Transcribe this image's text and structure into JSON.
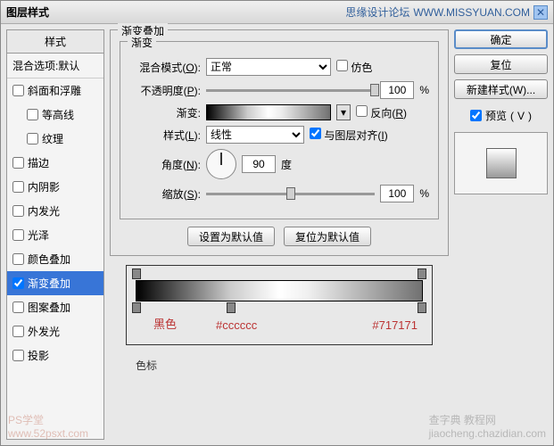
{
  "titlebar": {
    "title": "图层样式",
    "site": "思缘设计论坛",
    "url": "WWW.MISSYUAN.COM",
    "close": "✕"
  },
  "styles": {
    "header": "样式",
    "blend_opt": "混合选项:默认",
    "items": [
      {
        "label": "斜面和浮雕",
        "checked": false
      },
      {
        "label": "等高线",
        "checked": false,
        "sub": true
      },
      {
        "label": "纹理",
        "checked": false,
        "sub": true
      },
      {
        "label": "描边",
        "checked": false
      },
      {
        "label": "内阴影",
        "checked": false
      },
      {
        "label": "内发光",
        "checked": false
      },
      {
        "label": "光泽",
        "checked": false
      },
      {
        "label": "颜色叠加",
        "checked": false
      },
      {
        "label": "渐变叠加",
        "checked": true,
        "selected": true
      },
      {
        "label": "图案叠加",
        "checked": false
      },
      {
        "label": "外发光",
        "checked": false
      },
      {
        "label": "投影",
        "checked": false
      }
    ]
  },
  "panel": {
    "title": "渐变叠加",
    "inner_title": "渐变",
    "blend_mode": {
      "label": "混合模式",
      "key": "O",
      "value": "正常",
      "dither": "仿色"
    },
    "opacity": {
      "label": "不透明度",
      "key": "P",
      "value": "100",
      "unit": "%"
    },
    "gradient": {
      "label": "渐变",
      "reverse": "反向",
      "reverse_key": "R"
    },
    "style": {
      "label": "样式",
      "key": "L",
      "value": "线性",
      "align": "与图层对齐",
      "align_key": "I"
    },
    "angle": {
      "label": "角度",
      "key": "N",
      "value": "90",
      "unit": "度"
    },
    "scale": {
      "label": "缩放",
      "key": "S",
      "value": "100",
      "unit": "%"
    },
    "defaults": {
      "set": "设置为默认值",
      "reset": "复位为默认值"
    }
  },
  "right": {
    "ok": "确定",
    "cancel": "复位",
    "new_style": "新建样式",
    "new_style_key": "W",
    "preview": "预览",
    "preview_key": "V"
  },
  "grad_ann": {
    "c1": "黑色",
    "c2": "#cccccc",
    "c3": "#717171",
    "swatch": "色标"
  },
  "wm": {
    "a": "PS学堂",
    "a2": "www.52psxt.com",
    "b": "查字典 教程网",
    "b2": "jiaocheng.chazidian.com"
  }
}
